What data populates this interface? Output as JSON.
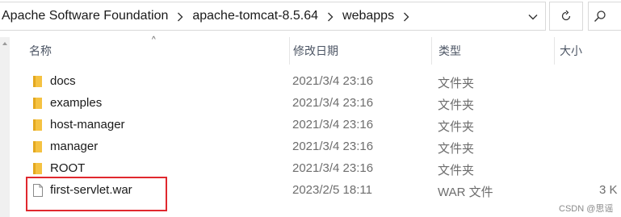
{
  "address_bar": {
    "breadcrumbs": [
      "Apache Software Foundation",
      "apache-tomcat-8.5.64",
      "webapps"
    ]
  },
  "columns": {
    "name": "名称",
    "date": "修改日期",
    "type": "类型",
    "size": "大小"
  },
  "files": [
    {
      "name": "docs",
      "date": "2021/3/4 23:16",
      "type": "文件夹",
      "size": "",
      "icon": "folder-icon"
    },
    {
      "name": "examples",
      "date": "2021/3/4 23:16",
      "type": "文件夹",
      "size": "",
      "icon": "folder-icon"
    },
    {
      "name": "host-manager",
      "date": "2021/3/4 23:16",
      "type": "文件夹",
      "size": "",
      "icon": "folder-icon"
    },
    {
      "name": "manager",
      "date": "2021/3/4 23:16",
      "type": "文件夹",
      "size": "",
      "icon": "folder-icon"
    },
    {
      "name": "ROOT",
      "date": "2021/3/4 23:16",
      "type": "文件夹",
      "size": "",
      "icon": "folder-icon"
    },
    {
      "name": "first-servlet.war",
      "date": "2023/2/5 18:11",
      "type": "WAR 文件",
      "size": "3 K",
      "icon": "file-icon"
    }
  ],
  "watermark": "CSDN @思谣",
  "colors": {
    "highlight": "#e0282e",
    "folder": "#f5c242"
  }
}
